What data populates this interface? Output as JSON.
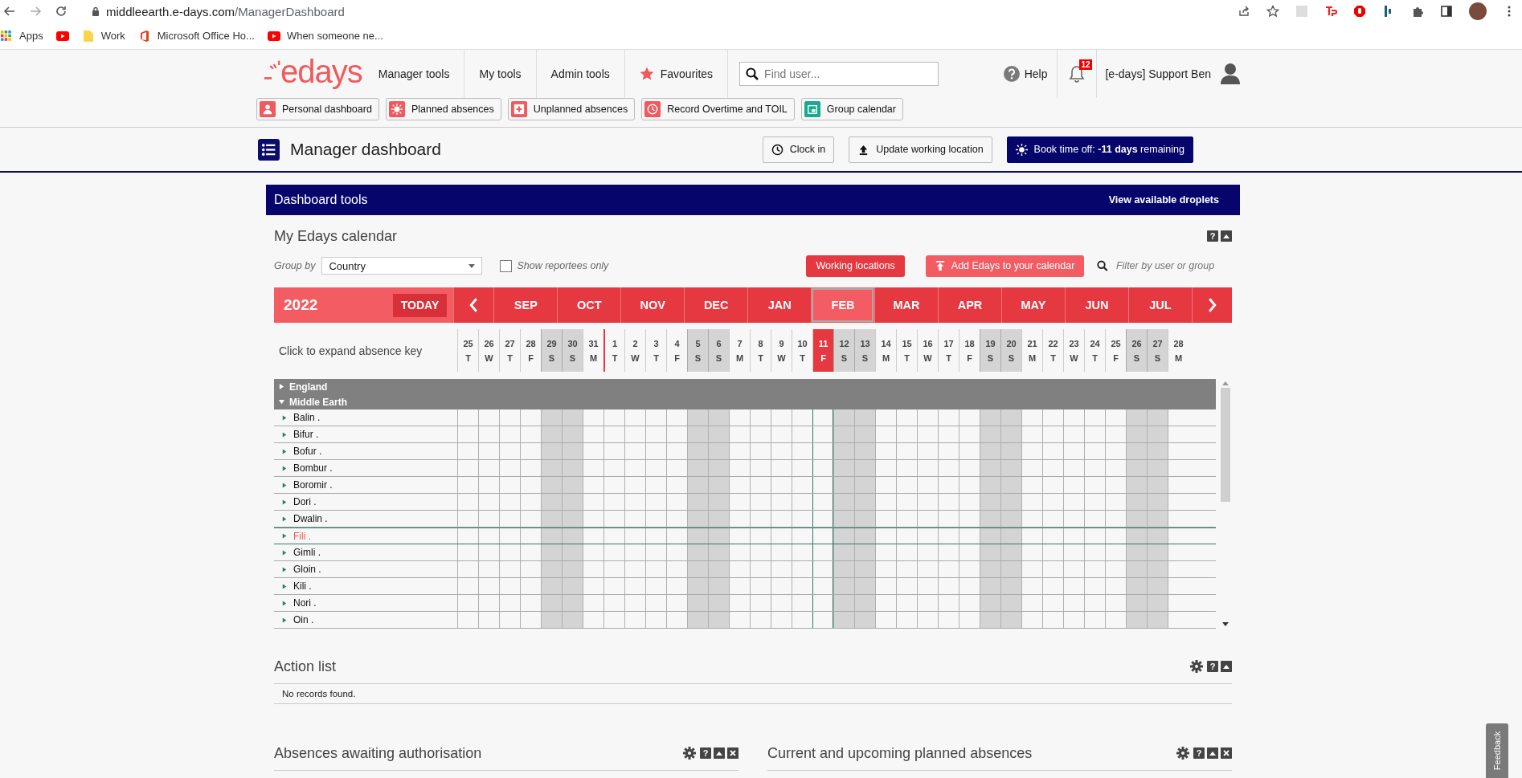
{
  "browser": {
    "url_domain": "middleearth.e-days.com",
    "url_path": "/ManagerDashboard",
    "bookmarks": [
      {
        "kind": "apps",
        "label": "Apps"
      },
      {
        "kind": "video"
      },
      {
        "kind": "folder",
        "label": "Work"
      },
      {
        "kind": "office",
        "label": "Microsoft Office Ho..."
      },
      {
        "kind": "video",
        "label": "When someone ne..."
      }
    ]
  },
  "header": {
    "logo": "edays",
    "nav": [
      {
        "label": "Manager tools",
        "kind": "plain"
      },
      {
        "label": "My tools",
        "kind": "plain"
      },
      {
        "label": "Admin tools",
        "kind": "plain"
      },
      {
        "label": "Favourites",
        "kind": "star"
      }
    ],
    "search_placeholder": "Find user...",
    "help": "Help",
    "notifications": "12",
    "user": "[e-days] Support Ben"
  },
  "quick_links": [
    {
      "label": "Personal dashboard",
      "kind": "person",
      "color": "#f05a5e"
    },
    {
      "label": "Planned absences",
      "kind": "sun",
      "color": "#f05a5e"
    },
    {
      "label": "Unplanned absences",
      "kind": "plus",
      "color": "#f05a5e"
    },
    {
      "label": "Record Overtime and TOIL",
      "kind": "clock",
      "color": "#f05a5e"
    },
    {
      "label": "Group calendar",
      "kind": "calendar",
      "color": "#19a98c"
    }
  ],
  "page": {
    "title": "Manager dashboard",
    "actions": [
      {
        "label": "Clock in",
        "kind": "clock"
      },
      {
        "label": "Update working location",
        "kind": "upload"
      },
      {
        "label": "Book time off: **-11 days** remaining",
        "kind": "primary"
      }
    ]
  },
  "tools_bar": {
    "title": "Dashboard tools",
    "link": "View available droplets"
  },
  "calendar": {
    "title": "My Edays calendar",
    "help": "?",
    "group_by_label": "Group by",
    "group_by_value": "Country",
    "show_reportees": {
      "label": "Show reportees only",
      "checked": false
    },
    "working_locations": "Working locations",
    "add_edays": "Add Edays to your calendar",
    "filter_placeholder": "Filter by user or group",
    "year": "2022",
    "today": "TODAY",
    "months": [
      {
        "label": "SEP",
        "selected": false
      },
      {
        "label": "OCT",
        "selected": false
      },
      {
        "label": "NOV",
        "selected": false
      },
      {
        "label": "DEC",
        "selected": false
      },
      {
        "label": "JAN",
        "selected": false
      },
      {
        "label": "FEB",
        "selected": true
      },
      {
        "label": "MAR",
        "selected": false
      },
      {
        "label": "APR",
        "selected": false
      },
      {
        "label": "MAY",
        "selected": false
      },
      {
        "label": "JUN",
        "selected": false
      },
      {
        "label": "JUL",
        "selected": false
      }
    ],
    "absence_key": "Click to expand absence key",
    "days": [
      {
        "num": "25",
        "dow": "T",
        "weekend": false,
        "today": false,
        "month_start": false
      },
      {
        "num": "26",
        "dow": "W",
        "weekend": false,
        "today": false,
        "month_start": false
      },
      {
        "num": "27",
        "dow": "T",
        "weekend": false,
        "today": false,
        "month_start": false
      },
      {
        "num": "28",
        "dow": "F",
        "weekend": false,
        "today": false,
        "month_start": false
      },
      {
        "num": "29",
        "dow": "S",
        "weekend": true,
        "today": false,
        "month_start": false
      },
      {
        "num": "30",
        "dow": "S",
        "weekend": true,
        "today": false,
        "month_start": false
      },
      {
        "num": "31",
        "dow": "M",
        "weekend": false,
        "today": false,
        "month_start": false
      },
      {
        "num": "1",
        "dow": "T",
        "weekend": false,
        "today": false,
        "month_start": true
      },
      {
        "num": "2",
        "dow": "W",
        "weekend": false,
        "today": false,
        "month_start": false
      },
      {
        "num": "3",
        "dow": "T",
        "weekend": false,
        "today": false,
        "month_start": false
      },
      {
        "num": "4",
        "dow": "F",
        "weekend": false,
        "today": false,
        "month_start": false
      },
      {
        "num": "5",
        "dow": "S",
        "weekend": true,
        "today": false,
        "month_start": false
      },
      {
        "num": "6",
        "dow": "S",
        "weekend": true,
        "today": false,
        "month_start": false
      },
      {
        "num": "7",
        "dow": "M",
        "weekend": false,
        "today": false,
        "month_start": false
      },
      {
        "num": "8",
        "dow": "T",
        "weekend": false,
        "today": false,
        "month_start": false
      },
      {
        "num": "9",
        "dow": "W",
        "weekend": false,
        "today": false,
        "month_start": false
      },
      {
        "num": "10",
        "dow": "T",
        "weekend": false,
        "today": false,
        "month_start": false
      },
      {
        "num": "11",
        "dow": "F",
        "weekend": false,
        "today": true,
        "month_start": false
      },
      {
        "num": "12",
        "dow": "S",
        "weekend": true,
        "today": false,
        "month_start": false
      },
      {
        "num": "13",
        "dow": "S",
        "weekend": true,
        "today": false,
        "month_start": false
      },
      {
        "num": "14",
        "dow": "M",
        "weekend": false,
        "today": false,
        "month_start": false
      },
      {
        "num": "15",
        "dow": "T",
        "weekend": false,
        "today": false,
        "month_start": false
      },
      {
        "num": "16",
        "dow": "W",
        "weekend": false,
        "today": false,
        "month_start": false
      },
      {
        "num": "17",
        "dow": "T",
        "weekend": false,
        "today": false,
        "month_start": false
      },
      {
        "num": "18",
        "dow": "F",
        "weekend": false,
        "today": false,
        "month_start": false
      },
      {
        "num": "19",
        "dow": "S",
        "weekend": true,
        "today": false,
        "month_start": false
      },
      {
        "num": "20",
        "dow": "S",
        "weekend": true,
        "today": false,
        "month_start": false
      },
      {
        "num": "21",
        "dow": "M",
        "weekend": false,
        "today": false,
        "month_start": false
      },
      {
        "num": "22",
        "dow": "T",
        "weekend": false,
        "today": false,
        "month_start": false
      },
      {
        "num": "23",
        "dow": "W",
        "weekend": false,
        "today": false,
        "month_start": false
      },
      {
        "num": "24",
        "dow": "T",
        "weekend": false,
        "today": false,
        "month_start": false
      },
      {
        "num": "25",
        "dow": "F",
        "weekend": false,
        "today": false,
        "month_start": false
      },
      {
        "num": "26",
        "dow": "S",
        "weekend": true,
        "today": false,
        "month_start": false
      },
      {
        "num": "27",
        "dow": "S",
        "weekend": true,
        "today": false,
        "month_start": false
      },
      {
        "num": "28",
        "dow": "M",
        "weekend": false,
        "today": false,
        "month_start": false
      }
    ],
    "groups": [
      {
        "name": "England",
        "expanded": false
      },
      {
        "name": "Middle Earth",
        "expanded": true,
        "people": [
          {
            "name": "Balin .",
            "selected": false
          },
          {
            "name": "Bifur .",
            "selected": false
          },
          {
            "name": "Bofur .",
            "selected": false
          },
          {
            "name": "Bombur .",
            "selected": false
          },
          {
            "name": "Boromir .",
            "selected": false
          },
          {
            "name": "Dori .",
            "selected": false
          },
          {
            "name": "Dwalin .",
            "selected": false
          },
          {
            "name": "Fili .",
            "selected": true
          },
          {
            "name": "Gimli .",
            "selected": false
          },
          {
            "name": "Gloin .",
            "selected": false
          },
          {
            "name": "Kili .",
            "selected": false
          },
          {
            "name": "Nori .",
            "selected": false
          },
          {
            "name": "Oin .",
            "selected": false
          }
        ]
      }
    ]
  },
  "panels": [
    {
      "title": "Action list",
      "tools": [
        {
          "kind": "gear"
        },
        {
          "kind": "help",
          "label": "?"
        },
        {
          "kind": "collapse"
        }
      ],
      "message": "No records found."
    }
  ],
  "half_panels": [
    {
      "title": "Absences awaiting authorisation",
      "tools": [
        {
          "kind": "gear"
        },
        {
          "kind": "help",
          "label": "?"
        },
        {
          "kind": "collapse"
        },
        {
          "kind": "close"
        }
      ]
    },
    {
      "title": "Current and upcoming planned absences",
      "tools": [
        {
          "kind": "gear"
        },
        {
          "kind": "help",
          "label": "?"
        },
        {
          "kind": "collapse"
        },
        {
          "kind": "close"
        }
      ]
    }
  ],
  "feedback": "Feedback"
}
